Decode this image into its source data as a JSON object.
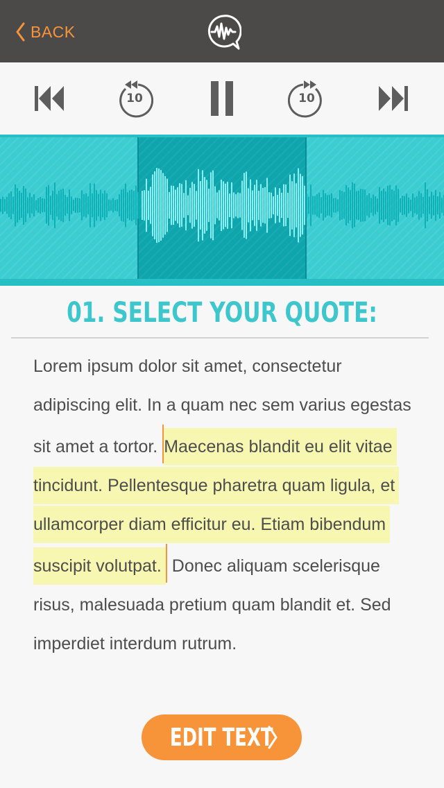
{
  "header": {
    "back_label": "BACK",
    "logo_icon": "waveform-speech-bubble-icon"
  },
  "controls": [
    {
      "name": "skip-back-button",
      "icon": "skip-back-icon"
    },
    {
      "name": "rewind-10-button",
      "icon": "rewind-10-icon",
      "label": "10"
    },
    {
      "name": "pause-button",
      "icon": "pause-icon"
    },
    {
      "name": "forward-10-button",
      "icon": "forward-10-icon",
      "label": "10"
    },
    {
      "name": "skip-forward-button",
      "icon": "skip-forward-icon"
    }
  ],
  "waveform": {
    "background_color": "#3ccdd2",
    "selection_color": "#0fa5ad",
    "wave_color": "#0cb0b6",
    "selected_wave_color": "#8af0f2"
  },
  "section": {
    "title": "01. SELECT YOUR QUOTE:"
  },
  "quote": {
    "before": "Lorem ipsum dolor sit amet, consectetur adipiscing elit. In a quam nec sem varius egestas sit amet a tortor. ",
    "highlighted": "Maecenas blandit eu elit vitae tincidunt. Pellentesque pharetra quam ligula, et ullamcorper diam efficitur eu. Etiam bibendum suscipit volutpat.",
    "after": " Donec aliquam scelerisque risus, malesuada pretium quam blandit et. Sed imperdiet interdum rutrum."
  },
  "edit_button": {
    "label": "EDIT TEXT"
  },
  "colors": {
    "accent": "#f7943a",
    "teal": "#3dc7cc",
    "header_bg": "#4b4a49",
    "highlight": "#f7f7b2"
  }
}
